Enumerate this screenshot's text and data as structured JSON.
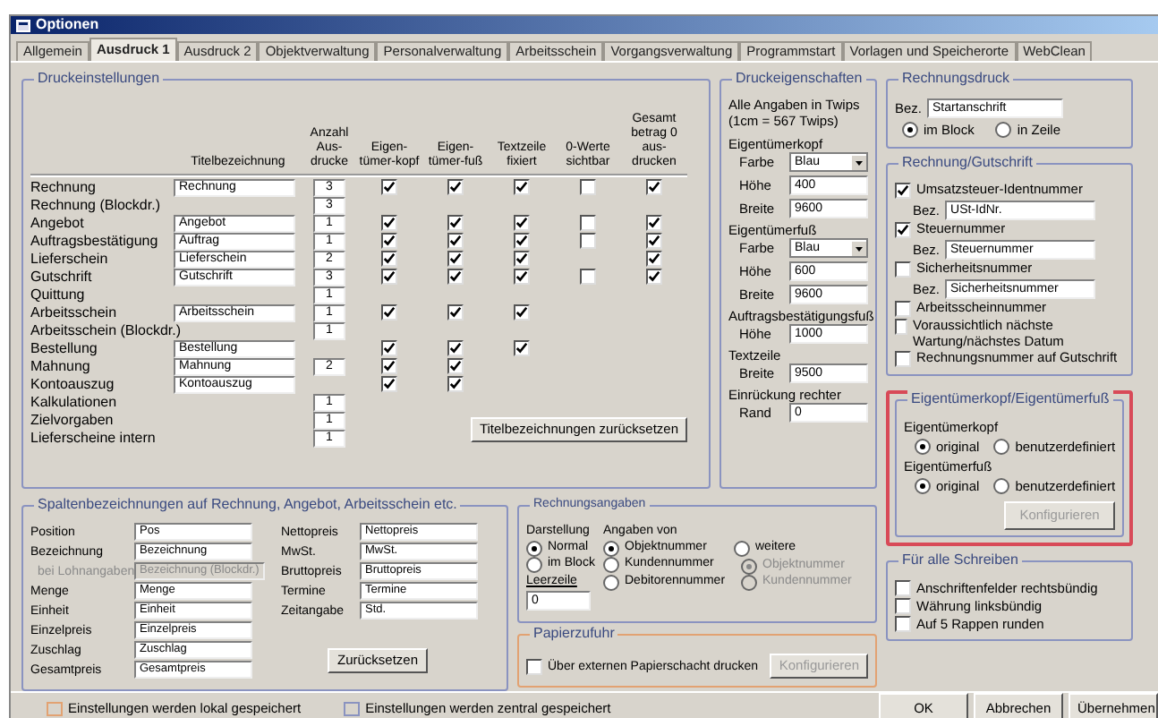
{
  "window": {
    "title": "Optionen"
  },
  "tabs": [
    {
      "label": "Allgemein",
      "selected": false
    },
    {
      "label": "Ausdruck 1",
      "selected": true
    },
    {
      "label": "Ausdruck 2",
      "selected": false
    },
    {
      "label": "Objektverwaltung",
      "selected": false
    },
    {
      "label": "Personalverwaltung",
      "selected": false
    },
    {
      "label": "Arbeitsschein",
      "selected": false
    },
    {
      "label": "Vorgangsverwaltung",
      "selected": false
    },
    {
      "label": "Programmstart",
      "selected": false
    },
    {
      "label": "Vorlagen und Speicherorte",
      "selected": false
    },
    {
      "label": "WebClean",
      "selected": false
    }
  ],
  "druckeinstellungen": {
    "title": "Druckeinstellungen",
    "stored_locally": false,
    "columns": [
      "Titelbezeichnung",
      "Anzahl Aus-drucke",
      "Eigen-tümer-kopf",
      "Eigen-tümer-fuß",
      "Textzeile fixiert",
      "0-Werte sichtbar",
      "Gesamt betrag 0 aus-drucken"
    ],
    "rows": [
      {
        "name": "Rechnung",
        "title": "Rechnung",
        "count": "3",
        "checks": {
          "kopf": true,
          "fuss": true,
          "textzeile": true,
          "nullwerte": false,
          "gesamt": true
        }
      },
      {
        "name": "Rechnung (Blockdr.)",
        "count": "3"
      },
      {
        "name": "Angebot",
        "title": "Angebot",
        "count": "1",
        "checks": {
          "kopf": true,
          "fuss": true,
          "textzeile": true,
          "nullwerte": false,
          "gesamt": true
        }
      },
      {
        "name": "Auftragsbestätigung",
        "title": "Auftrag",
        "count": "1",
        "checks": {
          "kopf": true,
          "fuss": true,
          "textzeile": true,
          "nullwerte": false,
          "gesamt": true
        }
      },
      {
        "name": "Lieferschein",
        "title": "Lieferschein",
        "count": "2",
        "checks": {
          "kopf": true,
          "fuss": true,
          "textzeile": true,
          "gesamt": true
        }
      },
      {
        "name": "Gutschrift",
        "title": "Gutschrift",
        "count": "3",
        "checks": {
          "kopf": true,
          "fuss": true,
          "textzeile": true,
          "nullwerte": false,
          "gesamt": true
        }
      },
      {
        "name": "Quittung",
        "count": "1"
      },
      {
        "name": "Arbeitsschein",
        "title": "Arbeitsschein",
        "count": "1",
        "checks": {
          "kopf": true,
          "fuss": true,
          "textzeile": true
        }
      },
      {
        "name": "Arbeitsschein (Blockdr.)",
        "count": "1"
      },
      {
        "name": "Bestellung",
        "title": "Bestellung",
        "checks": {
          "kopf": true,
          "fuss": true,
          "textzeile": true
        }
      },
      {
        "name": "Mahnung",
        "title": "Mahnung",
        "count": "2",
        "checks": {
          "kopf": true,
          "fuss": true
        }
      },
      {
        "name": "Kontoauszug",
        "title": "Kontoauszug",
        "checks": {
          "kopf": true,
          "fuss": true
        }
      },
      {
        "name": "Kalkulationen",
        "count": "1"
      },
      {
        "name": "Zielvorgaben",
        "count": "1"
      },
      {
        "name": "Lieferscheine intern",
        "count": "1"
      }
    ],
    "reset_button": "Titelbezeichnungen zurücksetzen"
  },
  "druckeigenschaften": {
    "title": "Druckeigenschaften",
    "stored_locally": false,
    "note": "Alle Angaben in Twips (1cm = 567 Twips)",
    "sections": [
      {
        "label": "Eigentümerkopf",
        "fields": [
          {
            "label": "Farbe",
            "value": "Blau",
            "kind": "dropdown"
          },
          {
            "label": "Höhe",
            "value": "400",
            "kind": "text"
          },
          {
            "label": "Breite",
            "value": "9600",
            "kind": "text"
          }
        ]
      },
      {
        "label": "Eigentümerfuß",
        "fields": [
          {
            "label": "Farbe",
            "value": "Blau",
            "kind": "dropdown"
          },
          {
            "label": "Höhe",
            "value": "600",
            "kind": "text"
          },
          {
            "label": "Breite",
            "value": "9600",
            "kind": "text"
          }
        ]
      },
      {
        "label": "Auftragsbestätigungsfuß",
        "fields": [
          {
            "label": "Höhe",
            "value": "1000",
            "kind": "text"
          }
        ]
      },
      {
        "label": "Textzeile",
        "fields": [
          {
            "label": "Breite",
            "value": "9500",
            "kind": "text"
          }
        ]
      },
      {
        "label": "Einrückung rechter",
        "fields": [
          {
            "label": "Rand",
            "value": "0",
            "kind": "text"
          }
        ]
      }
    ]
  },
  "spaltenbezeichnungen": {
    "title": "Spaltenbezeichnungen auf Rechnung, Angebot, Arbeitsschein etc.",
    "stored_locally": false,
    "left": [
      {
        "label": "Position",
        "value": "Pos",
        "disabled": false
      },
      {
        "label": "Bezeichnung",
        "value": "Bezeichnung",
        "disabled": false
      },
      {
        "label": "bei Lohnangaben",
        "value": "Bezeichnung (Blockdr.)",
        "disabled": true
      },
      {
        "label": "Menge",
        "value": "Menge",
        "disabled": false
      },
      {
        "label": "Einheit",
        "value": "Einheit",
        "disabled": false
      },
      {
        "label": "Einzelpreis",
        "value": "Einzelpreis",
        "disabled": false
      },
      {
        "label": "Zuschlag",
        "value": "Zuschlag",
        "disabled": false
      },
      {
        "label": "Gesamtpreis",
        "value": "Gesamtpreis",
        "disabled": false
      }
    ],
    "right": [
      {
        "label": "Nettopreis",
        "value": "Nettopreis",
        "disabled": false
      },
      {
        "label": "MwSt.",
        "value": "MwSt.",
        "disabled": false
      },
      {
        "label": "Bruttopreis",
        "value": "Bruttopreis",
        "disabled": false
      },
      {
        "label": "Termine",
        "value": "Termine",
        "disabled": false
      },
      {
        "label": "Zeitangabe",
        "value": "Std.",
        "disabled": false
      }
    ],
    "button": "Zurücksetzen"
  },
  "rechnungsangaben": {
    "title": "Rechnungsangaben",
    "stored_locally": false,
    "darstellung": {
      "label": "Darstellung",
      "options": [
        {
          "label": "Normal",
          "selected": true
        },
        {
          "label": "im Block",
          "selected": false
        }
      ]
    },
    "leerzeile": {
      "label": "Leerzeile",
      "value": "0"
    },
    "angaben": {
      "label": "Angaben von",
      "options": [
        {
          "label": "Objektnummer",
          "selected": true
        },
        {
          "label": "Kundennummer",
          "selected": false
        },
        {
          "label": "Debitorennummer",
          "selected": false
        }
      ]
    },
    "weitere": {
      "label": "weitere",
      "selected": false
    },
    "weitere_options": [
      {
        "label": "Objektnummer",
        "selected": true,
        "disabled": true
      },
      {
        "label": "Kundennummer",
        "selected": false,
        "disabled": true
      }
    ]
  },
  "papierzufuhr": {
    "title": "Papierzufuhr",
    "stored_locally": true,
    "checkbox": {
      "label": "Über externen Papierschacht drucken",
      "checked": false
    },
    "button": {
      "label": "Konfigurieren",
      "disabled": true
    }
  },
  "rechnungsdruck": {
    "title": "Rechnungsdruck",
    "stored_locally": false,
    "field": {
      "label": "Bez.",
      "value": "Startanschrift"
    },
    "options": [
      {
        "label": "im Block",
        "selected": true
      },
      {
        "label": "in Zeile",
        "selected": false
      }
    ]
  },
  "rechnung_gutschrift": {
    "title": "Rechnung/Gutschrift",
    "stored_locally": false,
    "items": [
      {
        "kind": "check",
        "label": "Umsatzsteuer-Identnummer",
        "checked": true
      },
      {
        "kind": "field",
        "label": "Bez.",
        "value": "USt-IdNr."
      },
      {
        "kind": "check",
        "label": "Steuernummer",
        "checked": true
      },
      {
        "kind": "field",
        "label": "Bez.",
        "value": "Steuernummer"
      },
      {
        "kind": "check",
        "label": "Sicherheitsnummer",
        "checked": false
      },
      {
        "kind": "field",
        "label": "Bez.",
        "value": "Sicherheitsnummer"
      },
      {
        "kind": "check",
        "label": "Arbeitsscheinnummer",
        "checked": false
      },
      {
        "kind": "check",
        "label": "Voraussichtlich nächste Wartung/nächstes Datum",
        "checked": false
      },
      {
        "kind": "check",
        "label": "Rechnungsnummer auf Gutschrift",
        "checked": false
      }
    ]
  },
  "eigentuemer": {
    "title": "Eigentümerkopf/Eigentümerfuß",
    "stored_locally": false,
    "highlighted": true,
    "sections": [
      {
        "label": "Eigentümerkopf",
        "options": [
          {
            "label": "original",
            "selected": true
          },
          {
            "label": "benutzerdefiniert",
            "selected": false
          }
        ]
      },
      {
        "label": "Eigentümerfuß",
        "options": [
          {
            "label": "original",
            "selected": true
          },
          {
            "label": "benutzerdefiniert",
            "selected": false
          }
        ]
      }
    ],
    "button": {
      "label": "Konfigurieren",
      "disabled": true
    }
  },
  "alle_schreiben": {
    "title": "Für alle Schreiben",
    "stored_locally": false,
    "checks": [
      {
        "label": "Anschriftenfelder rechtsbündig",
        "checked": false
      },
      {
        "label": "Währung linksbündig",
        "checked": false
      },
      {
        "label": "Auf 5 Rappen runden",
        "checked": false
      }
    ]
  },
  "legend": [
    {
      "stored_locally": true,
      "label": "Einstellungen werden lokal gespeichert"
    },
    {
      "stored_locally": false,
      "label": "Einstellungen werden zentral gespeichert"
    }
  ],
  "buttons": [
    "OK",
    "Abbrechen",
    "Übernehmen"
  ]
}
